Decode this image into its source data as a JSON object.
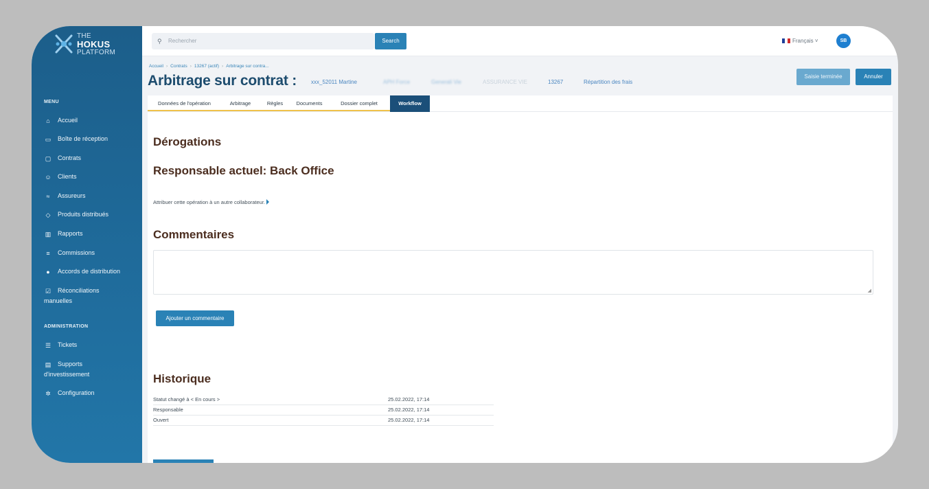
{
  "app": {
    "logo_line1": "THE",
    "logo_line2": "HOKUS",
    "logo_line3": "PLATFORM"
  },
  "sidebar": {
    "menu_title": "MENU",
    "items": [
      {
        "label": "Accueil",
        "icon": "home-icon"
      },
      {
        "label": "Boîte de réception",
        "icon": "inbox-icon"
      },
      {
        "label": "Contrats",
        "icon": "clipboard-icon"
      },
      {
        "label": "Clients",
        "icon": "users-icon"
      },
      {
        "label": "Assureurs",
        "icon": "handshake-icon"
      },
      {
        "label": "Produits distribués",
        "icon": "box-icon"
      },
      {
        "label": "Rapports",
        "icon": "books-icon"
      },
      {
        "label": "Commissions",
        "icon": "coins-icon"
      },
      {
        "label": "Accords de distribution",
        "icon": "chat-icon"
      },
      {
        "label": "Réconciliations",
        "label2": "manuelles",
        "icon": "checkbox-icon"
      }
    ],
    "admin_title": "ADMINISTRATION",
    "admin_items": [
      {
        "label": "Tickets",
        "icon": "list-icon"
      },
      {
        "label": "Supports",
        "label2": "d'investissement",
        "icon": "chart-icon"
      },
      {
        "label": "Configuration",
        "icon": "gear-icon"
      }
    ]
  },
  "topbar": {
    "search_placeholder": "Rechercher",
    "search_button": "Search",
    "language": "Français",
    "avatar_initials": "SB"
  },
  "breadcrumb": [
    "Accueil",
    "Contrats",
    "13267 (actif)",
    "Arbitrage sur contra..."
  ],
  "page": {
    "title": "Arbitrage sur contrat :",
    "meta_client": "xxx_52011 Martine",
    "meta_blur1": "APH Force",
    "meta_blur2": "Generali Vie",
    "meta_product": "ASSURANCE VIE",
    "meta_contract": "13267",
    "meta_link": "Répartition des frais",
    "btn_done": "Saisie terminée",
    "btn_cancel": "Annuler"
  },
  "tabs": [
    "Données de l'opération",
    "Arbitrage",
    "Règles",
    "Documents",
    "Dossier complet",
    "Workflow"
  ],
  "workflow": {
    "derogations_title": "Dérogations",
    "responsable_title": "Responsable actuel: Back Office",
    "assign_text": "Attribuer cette opération à un autre collaborateur.",
    "comments_title": "Commentaires",
    "comment_value": "",
    "add_comment_button": "Ajouter un commentaire",
    "history_title": "Historique",
    "history": [
      {
        "event": "Statut changé à < En cours >",
        "date": "25.02.2022, 17:14"
      },
      {
        "event": "Responsable",
        "date": "25.02.2022, 17:14"
      },
      {
        "event": "Ouvert",
        "date": "25.02.2022, 17:14"
      }
    ]
  },
  "colors": {
    "sidebar": "#1f6b9b",
    "primary": "#2a82b6",
    "title": "#1d4c6e",
    "heading": "#4b2d1f",
    "tab_active": "#1b4f79",
    "tab_underline": "#f0c24b"
  }
}
